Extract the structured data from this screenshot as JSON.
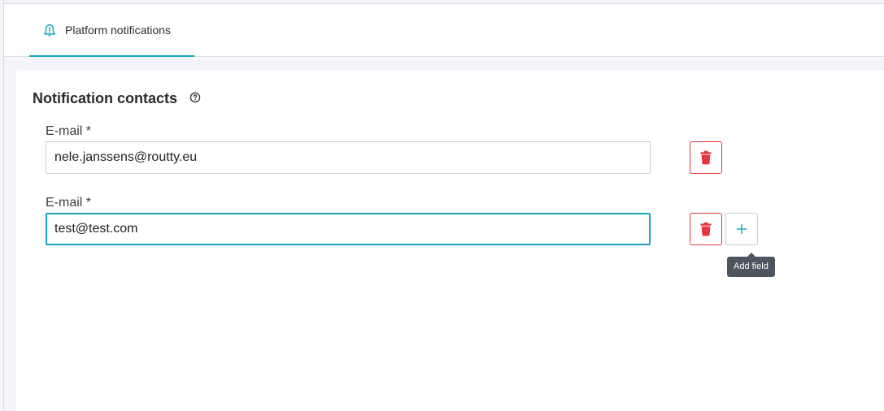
{
  "tabs": [
    {
      "label": "Platform notifications",
      "icon": "bell-icon",
      "active": true
    }
  ],
  "section": {
    "title": "Notification contacts",
    "help_icon": "question-circle-icon"
  },
  "fields": [
    {
      "label": "E-mail *",
      "value": "nele.janssens@routty.eu"
    },
    {
      "label": "E-mail *",
      "value": "test@test.com"
    }
  ],
  "actions": {
    "delete_icon": "trash-icon",
    "add_icon": "plus-icon",
    "add_tooltip": "Add field"
  },
  "colors": {
    "accent": "#1aa5bd",
    "danger": "#e0393e",
    "tooltip_bg": "#4d5560"
  }
}
